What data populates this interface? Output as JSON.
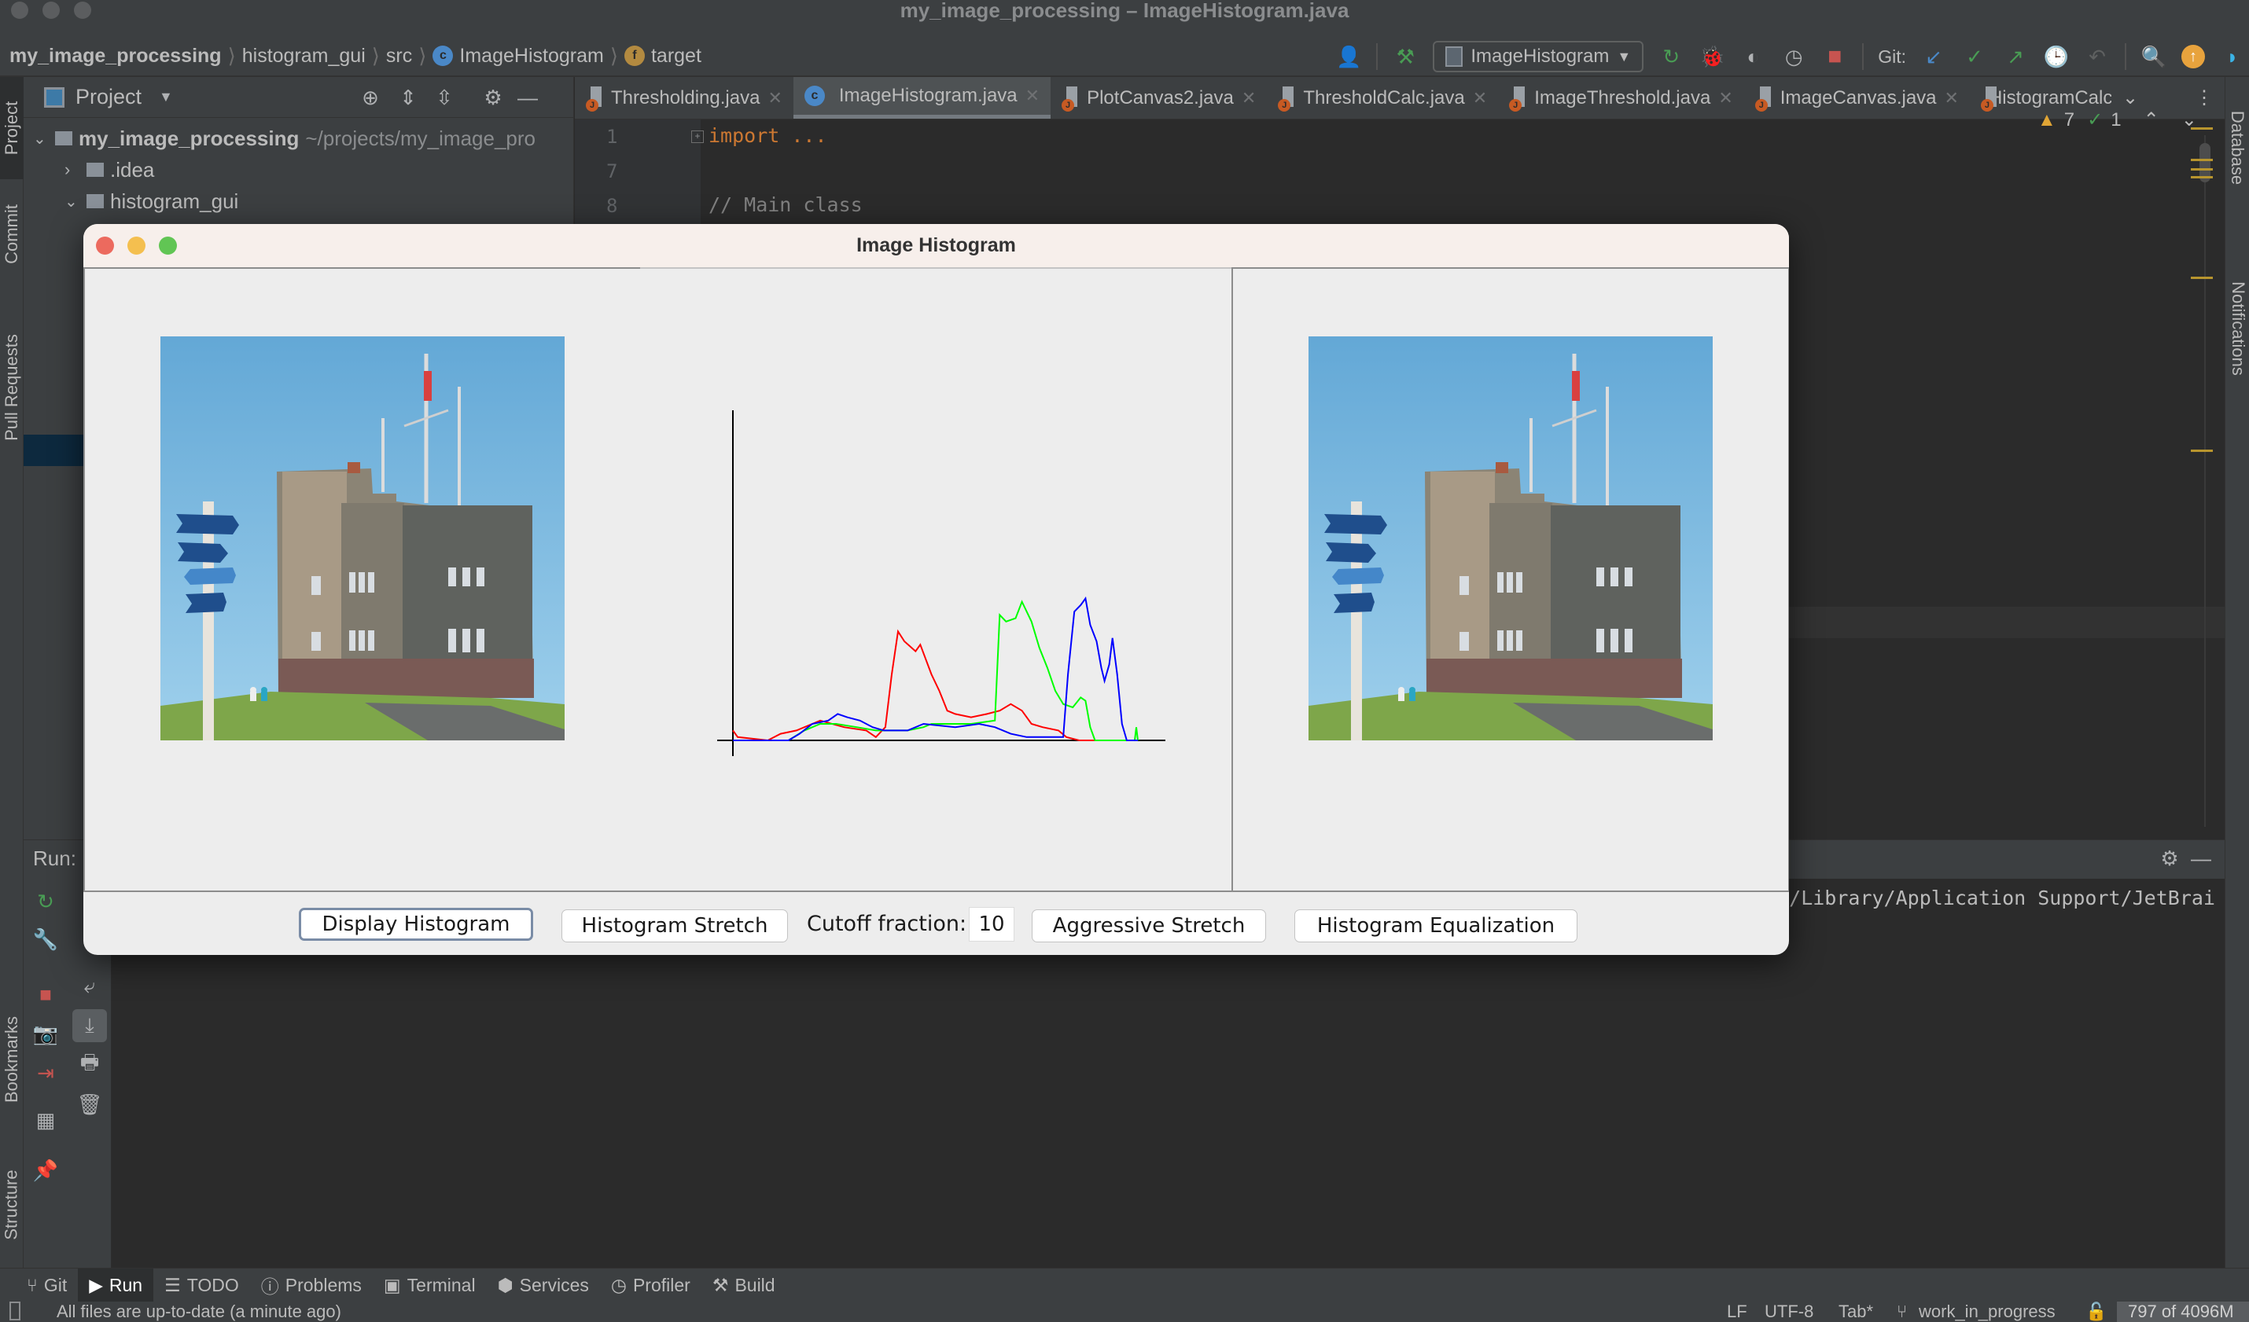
{
  "window": {
    "title": "my_image_processing – ImageHistogram.java"
  },
  "breadcrumb": [
    {
      "label": "my_image_processing",
      "bold": true
    },
    {
      "label": "histogram_gui"
    },
    {
      "label": "src"
    },
    {
      "label": "ImageHistogram",
      "icon": "class-icon"
    },
    {
      "label": "target",
      "icon": "field-icon"
    }
  ],
  "toolbar": {
    "run_config": "ImageHistogram",
    "git_label": "Git:"
  },
  "left_stripe": {
    "tabs": [
      "Project",
      "Commit",
      "Pull Requests",
      "Bookmarks",
      "Structure"
    ]
  },
  "right_stripe": {
    "tabs": [
      "Database",
      "Notifications"
    ]
  },
  "project": {
    "header": "Project",
    "tree": [
      {
        "label": "my_image_processing",
        "suffix": "~/projects/my_image_pro",
        "expanded": true,
        "level": 0
      },
      {
        "label": ".idea",
        "expanded": false,
        "level": 1
      },
      {
        "label": "histogram_gui",
        "expanded": true,
        "level": 1
      }
    ]
  },
  "editor": {
    "tabs": [
      {
        "label": "Thresholding.java",
        "active": false
      },
      {
        "label": "ImageHistogram.java",
        "active": true
      },
      {
        "label": "PlotCanvas2.java",
        "active": false
      },
      {
        "label": "ThresholdCalc.java",
        "active": false
      },
      {
        "label": "ImageThreshold.java",
        "active": false
      },
      {
        "label": "ImageCanvas.java",
        "active": false
      },
      {
        "label": "HistogramCalc",
        "active": false
      }
    ],
    "lines": [
      {
        "number": "1",
        "text": "import ..."
      },
      {
        "number": "7",
        "text": ""
      },
      {
        "number": "8",
        "text": "// Main class"
      }
    ],
    "inspections": {
      "warnings": "7",
      "weak_warnings": "1"
    }
  },
  "run_panel": {
    "label": "Run:",
    "console_text": "/Library/Application Support/JetBrai"
  },
  "dialog": {
    "title": "Image Histogram",
    "buttons": {
      "display_histogram": "Display Histogram",
      "histogram_stretch": "Histogram Stretch",
      "cutoff_label": "Cutoff fraction:",
      "cutoff_value": "10",
      "aggressive_stretch": "Aggressive Stretch",
      "histogram_equalization": "Histogram Equalization"
    },
    "image_description": "Cabot Tower stone building with flag masts and blue direction signpost under clear sky"
  },
  "chart_data": {
    "type": "line",
    "title": "",
    "xlabel": "",
    "ylabel": "",
    "xlim": [
      0,
      255
    ],
    "ylim": [
      0,
      1
    ],
    "grid": false,
    "legend": "none",
    "x_note": "intensity bins 0-255, relative counts normalized to y-axis height",
    "series": [
      {
        "name": "red",
        "color": "#ff0000",
        "points": [
          [
            0,
            0.03
          ],
          [
            3,
            0.01
          ],
          [
            22,
            0
          ],
          [
            30,
            0.02
          ],
          [
            40,
            0.03
          ],
          [
            55,
            0.06
          ],
          [
            70,
            0.04
          ],
          [
            84,
            0.03
          ],
          [
            90,
            0.01
          ],
          [
            96,
            0.04
          ],
          [
            100,
            0.2
          ],
          [
            104,
            0.33
          ],
          [
            108,
            0.3
          ],
          [
            115,
            0.27
          ],
          [
            118,
            0.29
          ],
          [
            125,
            0.2
          ],
          [
            130,
            0.15
          ],
          [
            135,
            0.09
          ],
          [
            140,
            0.08
          ],
          [
            150,
            0.07
          ],
          [
            160,
            0.08
          ],
          [
            168,
            0.09
          ],
          [
            175,
            0.11
          ],
          [
            182,
            0.09
          ],
          [
            188,
            0.05
          ],
          [
            195,
            0.04
          ],
          [
            205,
            0.03
          ],
          [
            210,
            0.01
          ],
          [
            218,
            0
          ],
          [
            255,
            0
          ]
        ]
      },
      {
        "name": "green",
        "color": "#00ff00",
        "points": [
          [
            0,
            0
          ],
          [
            35,
            0
          ],
          [
            45,
            0.03
          ],
          [
            55,
            0.05
          ],
          [
            65,
            0.05
          ],
          [
            78,
            0.04
          ],
          [
            90,
            0.03
          ],
          [
            110,
            0.03
          ],
          [
            120,
            0.04
          ],
          [
            125,
            0.05
          ],
          [
            138,
            0.05
          ],
          [
            150,
            0.05
          ],
          [
            165,
            0.06
          ],
          [
            168,
            0.38
          ],
          [
            172,
            0.36
          ],
          [
            178,
            0.37
          ],
          [
            182,
            0.42
          ],
          [
            188,
            0.36
          ],
          [
            193,
            0.28
          ],
          [
            198,
            0.22
          ],
          [
            203,
            0.15
          ],
          [
            208,
            0.11
          ],
          [
            214,
            0.1
          ],
          [
            219,
            0.13
          ],
          [
            222,
            0.12
          ],
          [
            225,
            0.04
          ],
          [
            228,
            0
          ],
          [
            253,
            0
          ],
          [
            254,
            0.04
          ],
          [
            255,
            0
          ]
        ]
      },
      {
        "name": "blue",
        "color": "#0000ff",
        "points": [
          [
            0,
            0
          ],
          [
            35,
            0
          ],
          [
            42,
            0.02
          ],
          [
            50,
            0.05
          ],
          [
            60,
            0.06
          ],
          [
            66,
            0.08
          ],
          [
            72,
            0.07
          ],
          [
            80,
            0.06
          ],
          [
            88,
            0.04
          ],
          [
            95,
            0.03
          ],
          [
            110,
            0.03
          ],
          [
            120,
            0.05
          ],
          [
            140,
            0.04
          ],
          [
            155,
            0.05
          ],
          [
            165,
            0.04
          ],
          [
            175,
            0.02
          ],
          [
            185,
            0.01
          ],
          [
            195,
            0.01
          ],
          [
            208,
            0.01
          ],
          [
            211,
            0.2
          ],
          [
            215,
            0.39
          ],
          [
            219,
            0.41
          ],
          [
            222,
            0.43
          ],
          [
            225,
            0.35
          ],
          [
            229,
            0.3
          ],
          [
            232,
            0.22
          ],
          [
            234,
            0.18
          ],
          [
            237,
            0.23
          ],
          [
            239,
            0.31
          ],
          [
            242,
            0.2
          ],
          [
            245,
            0.05
          ],
          [
            248,
            0
          ],
          [
            255,
            0
          ]
        ]
      }
    ]
  },
  "bottom_toolbar": {
    "items": [
      {
        "label": "Git",
        "icon": "git-branch-icon"
      },
      {
        "label": "Run",
        "icon": "run-icon",
        "active": true
      },
      {
        "label": "TODO",
        "icon": "todo-list-icon"
      },
      {
        "label": "Problems",
        "icon": "problems-icon"
      },
      {
        "label": "Terminal",
        "icon": "terminal-icon"
      },
      {
        "label": "Services",
        "icon": "services-icon"
      },
      {
        "label": "Profiler",
        "icon": "profiler-icon"
      },
      {
        "label": "Build",
        "icon": "build-hammer-icon"
      }
    ]
  },
  "status_bar": {
    "message": "All files are up-to-date (a minute ago)",
    "line_separator": "LF",
    "encoding": "UTF-8",
    "indent": "Tab*",
    "branch": "work_in_progress",
    "memory": "797 of 4096M"
  },
  "colors": {
    "accent_blue": "#4a88c7",
    "run_green": "#499c54",
    "stop_red": "#c75450",
    "warning_yellow": "#e0a535"
  }
}
